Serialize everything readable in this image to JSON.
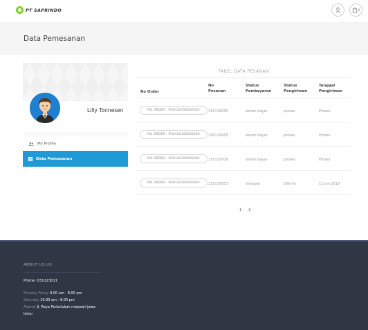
{
  "header": {
    "brand": "PT SAPRINDO",
    "cart_count": "0",
    "icons": [
      "user-icon",
      "shopping-bag-icon"
    ]
  },
  "page": {
    "title": "Data Pemesanan"
  },
  "profile": {
    "name": "Lilly Tonnesen",
    "menu": [
      {
        "label": "My Profile",
        "icon": "users-icon",
        "active": false
      },
      {
        "label": "Data Pemesanan",
        "icon": "list-icon",
        "active": true
      }
    ]
  },
  "table": {
    "caption": "TABEL DATA PESANAN",
    "headers": {
      "order": "No Order",
      "pesanan_1": "No",
      "pesanan_2": "Pesanan",
      "bayar_1": "Status",
      "bayar_2": "Pembayaran",
      "kirim_1": "Status",
      "kirim_2": "Pengiriman",
      "tanggal_1": "Tanggal",
      "tanggal_2": "Pengiriman"
    },
    "rows": [
      {
        "order": "NO ORDER : PO0120190000004",
        "no_pesanan": "150119050",
        "pembayaran": "belum bayar",
        "pengiriman": "proses",
        "tanggal": "Proses"
      },
      {
        "order": "NO ORDER : PO0120190000006",
        "no_pesanan": "140119065",
        "pembayaran": "belum bayar",
        "pengiriman": "proses",
        "tanggal": "Proses"
      },
      {
        "order": "NO ORDER : PO0120190000004",
        "no_pesanan": "110119709",
        "pembayaran": "belum bayar",
        "pengiriman": "proses",
        "tanggal": "Proses"
      },
      {
        "order": "NO ORDER : PO0120190000003",
        "no_pesanan": "110119553",
        "pembayaran": "terbayar",
        "pengiriman": "Dikirim",
        "tanggal": "11 Jan 2019"
      }
    ]
  },
  "pagination": {
    "pages": [
      "1",
      "2"
    ]
  },
  "footer": {
    "heading": "ABOUT US US",
    "phone": "Phone: 031123011",
    "hours_1_label": "Monday Friday",
    "hours_1_value": "9.00 am - 8.00 pm",
    "hours_2_label": "Saturday",
    "hours_2_value": "10.00 am - 6.00 pm",
    "address_label": "Alamat",
    "address_value_1": "Jl. Raya Perkutukan mojosari jawa",
    "address_value_2": "timur"
  },
  "colors": {
    "accent": "#1e9bd7",
    "brand_green": "#7ed321",
    "footer_bg": "#2f3644"
  }
}
